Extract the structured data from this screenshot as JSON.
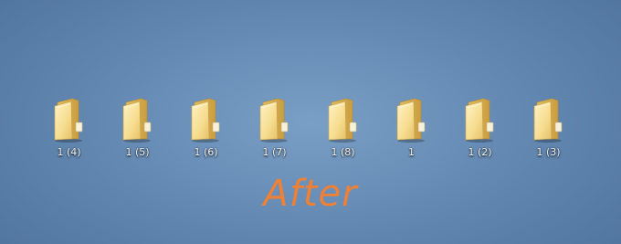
{
  "desktop": {
    "icons": [
      {
        "label": "1 (4)",
        "icon": "folder-icon"
      },
      {
        "label": "1 (5)",
        "icon": "folder-icon"
      },
      {
        "label": "1 (6)",
        "icon": "folder-icon"
      },
      {
        "label": "1 (7)",
        "icon": "folder-icon"
      },
      {
        "label": "1 (8)",
        "icon": "folder-icon"
      },
      {
        "label": "1",
        "icon": "folder-icon"
      },
      {
        "label": "1 (2)",
        "icon": "folder-icon"
      },
      {
        "label": "1 (3)",
        "icon": "folder-icon"
      }
    ],
    "caption": "After"
  },
  "colors": {
    "background": "#6388b2",
    "folder": "#f3d585",
    "caption": "#ee8136",
    "label": "#ffffff"
  }
}
